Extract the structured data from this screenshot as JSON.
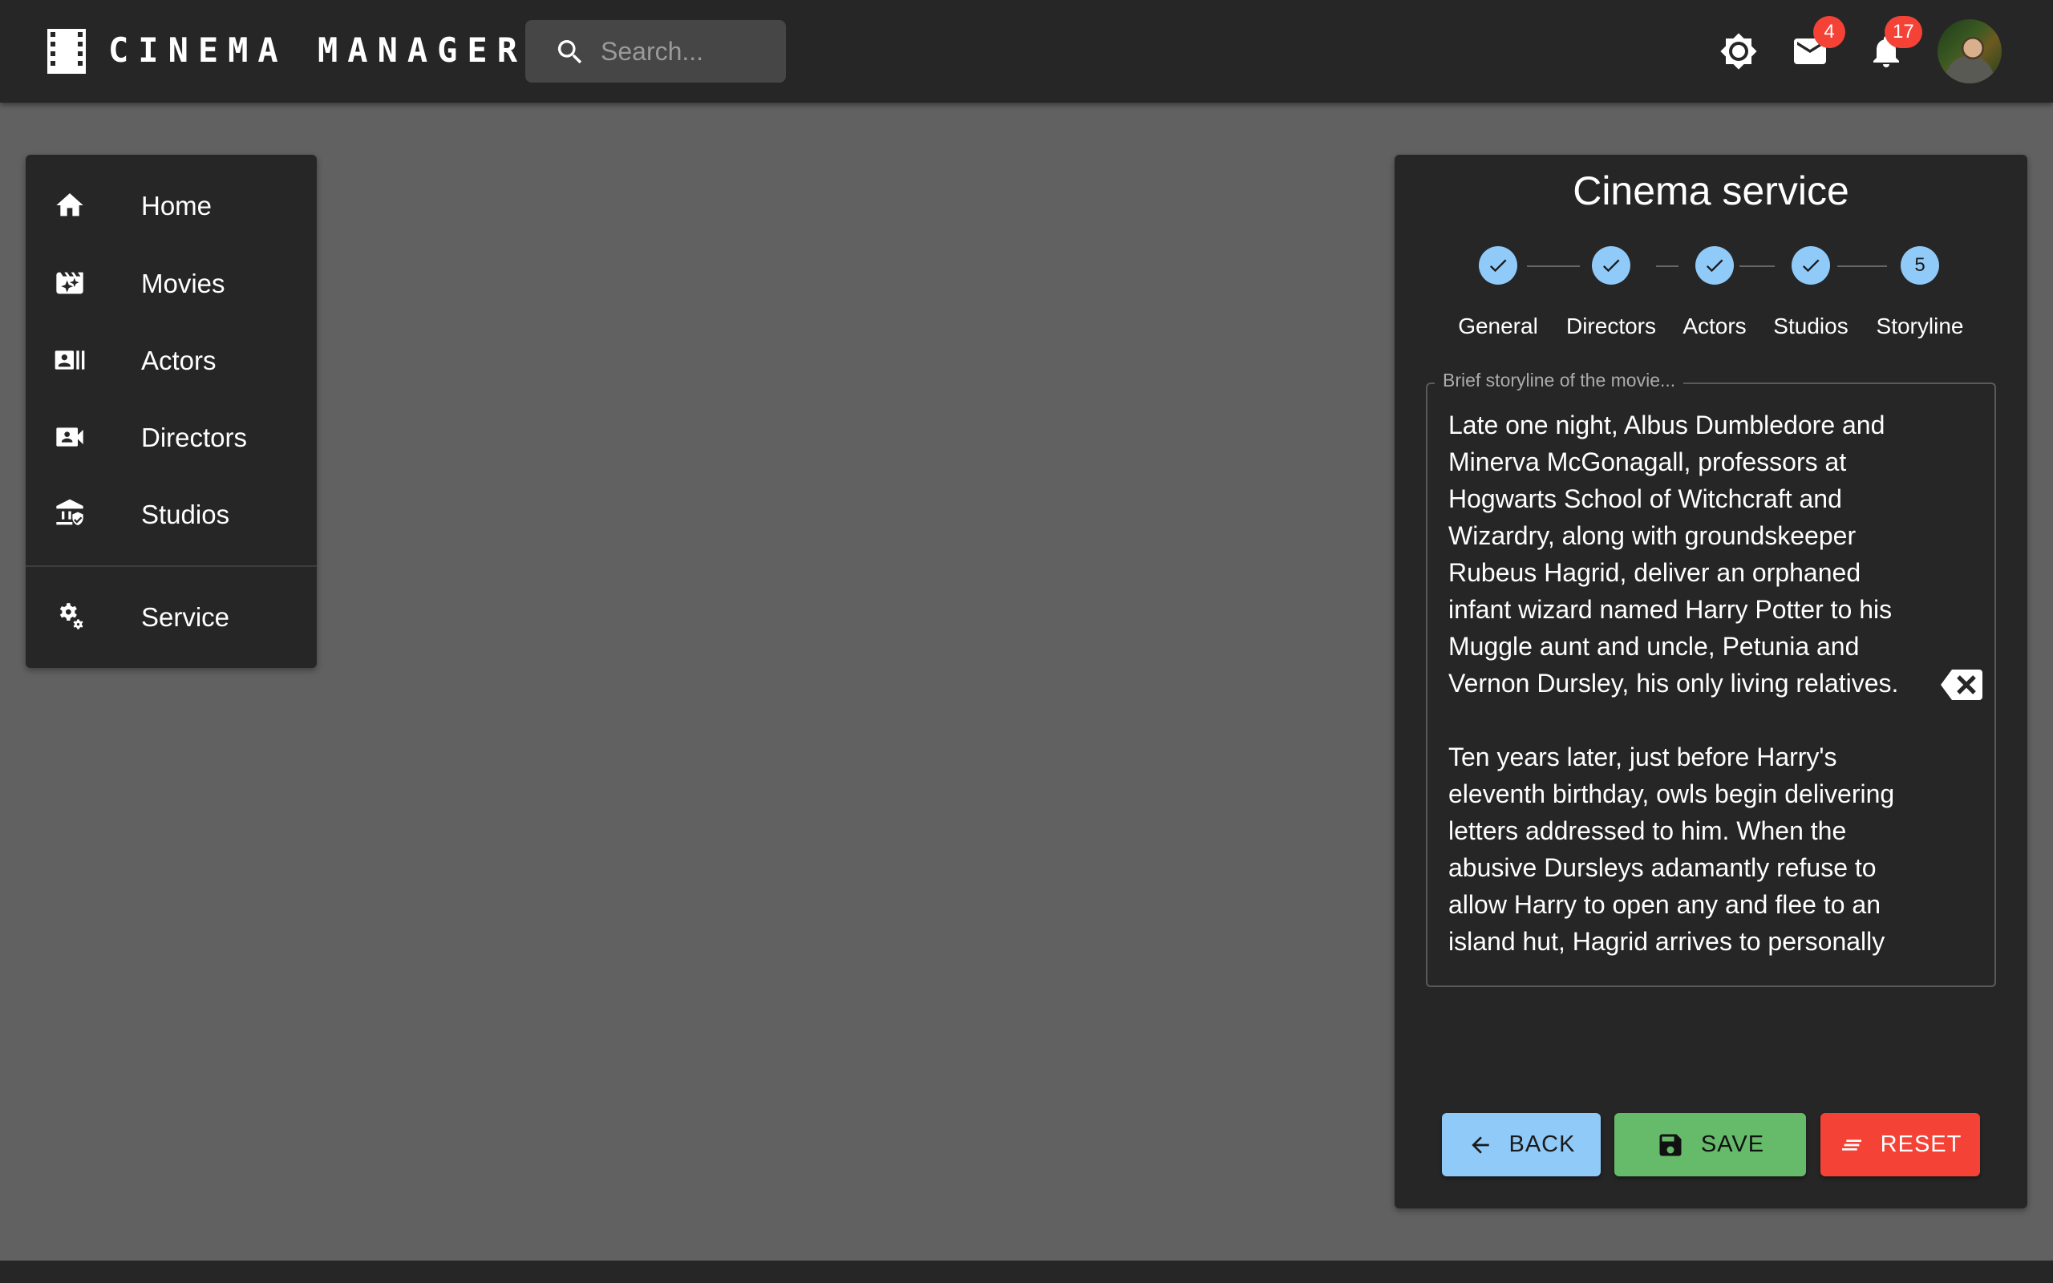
{
  "header": {
    "app_title": "CINEMA MANAGER",
    "search_placeholder": "Search...",
    "mail_badge": "4",
    "notifications_badge": "17",
    "icons": [
      "film-icon",
      "search-icon",
      "brightness-icon",
      "mail-icon",
      "bell-icon",
      "avatar"
    ]
  },
  "sidebar": {
    "items": [
      {
        "label": "Home",
        "icon": "home-icon"
      },
      {
        "label": "Movies",
        "icon": "movie-filter-icon"
      },
      {
        "label": "Actors",
        "icon": "recent-actors-icon"
      },
      {
        "label": "Directors",
        "icon": "video-camera-front-icon"
      },
      {
        "label": "Studios",
        "icon": "account-balance-icon"
      },
      {
        "label": "Service",
        "icon": "settings-icon"
      }
    ]
  },
  "panel": {
    "title": "Cinema service",
    "steps": [
      {
        "label": "General",
        "state": "completed"
      },
      {
        "label": "Directors",
        "state": "completed"
      },
      {
        "label": "Actors",
        "state": "completed"
      },
      {
        "label": "Studios",
        "state": "completed"
      },
      {
        "label": "Storyline",
        "state": "active",
        "number": "5"
      }
    ],
    "storyline_label": "Brief storyline of the movie...",
    "storyline_value": "Late one night, Albus Dumbledore and Minerva McGonagall, professors at Hogwarts School of Witchcraft and Wizardry, along with groundskeeper Rubeus Hagrid, deliver an orphaned infant wizard named Harry Potter to his Muggle aunt and uncle, Petunia and Vernon Dursley, his only living relatives.\n\nTen years later, just before Harry's eleventh birthday, owls begin delivering letters addressed to him. When the abusive Dursleys adamantly refuse to allow Harry to open any and flee to an island hut, Hagrid arrives to personally",
    "buttons": {
      "back": "BACK",
      "save": "SAVE",
      "reset": "RESET"
    }
  },
  "colors": {
    "accent": "#90caf9",
    "save": "#66bb6a",
    "reset": "#f44336",
    "badge": "#f44336"
  }
}
